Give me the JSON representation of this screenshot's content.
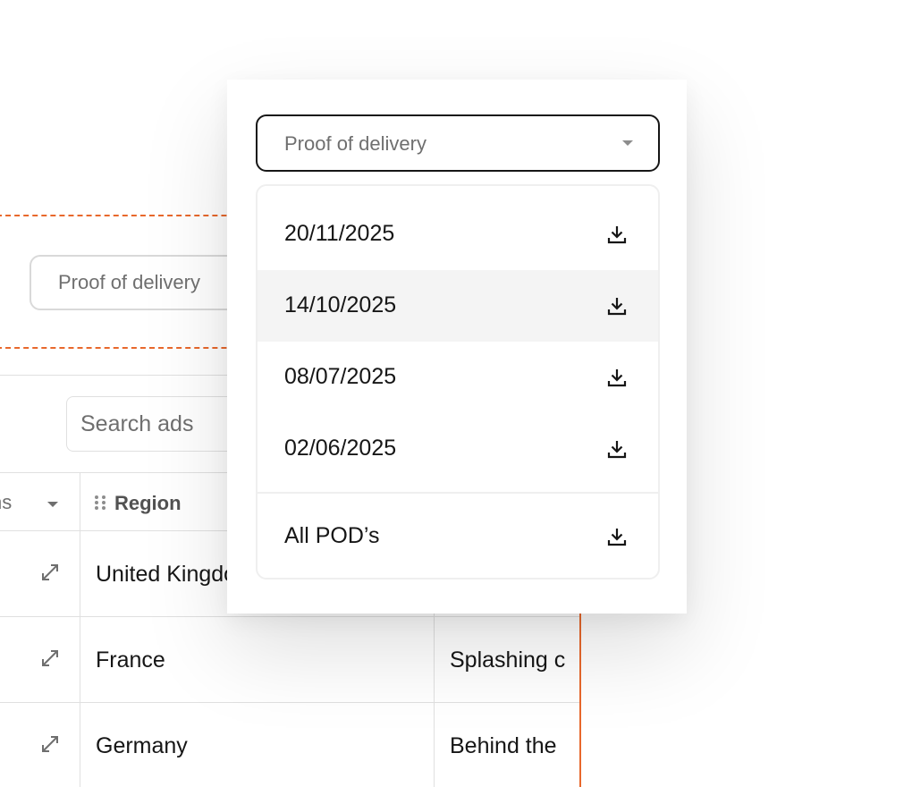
{
  "background": {
    "toolbar": {
      "filter_select_value": "Proof of delivery",
      "search_placeholder": "Search ads"
    },
    "table": {
      "columns": [
        {
          "label": "ns",
          "sortable": true
        },
        {
          "label": "Region",
          "draggable": true
        },
        {
          "label": ""
        }
      ],
      "rows": [
        {
          "region": "United Kingdom",
          "description": ""
        },
        {
          "region": "France",
          "description": "Splashing c"
        },
        {
          "region": "Germany",
          "description": "Behind the"
        }
      ]
    }
  },
  "popover": {
    "select": {
      "value": "Proof of delivery"
    },
    "options": [
      {
        "label": "20/11/2025",
        "icon": "download-icon",
        "hovered": false
      },
      {
        "label": "14/10/2025",
        "icon": "download-icon",
        "hovered": true
      },
      {
        "label": "08/07/2025",
        "icon": "download-icon",
        "hovered": false
      },
      {
        "label": "02/06/2025",
        "icon": "download-icon",
        "hovered": false
      }
    ],
    "footer_option": {
      "label": "All POD’s",
      "icon": "download-icon"
    }
  },
  "colors": {
    "accent": "#e8682c",
    "text_primary": "#161616",
    "text_secondary": "#6f6f6f",
    "hover_bg": "#f4f4f4",
    "border": "#e0e0e0"
  }
}
